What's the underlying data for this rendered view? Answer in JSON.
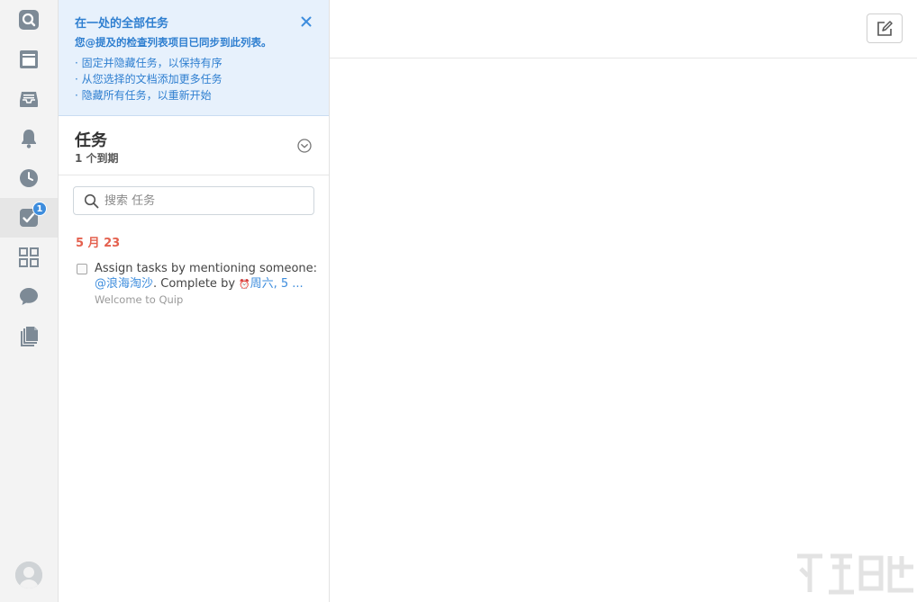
{
  "rail": {
    "items": [
      {
        "icon": "search-icon"
      },
      {
        "icon": "document-icon"
      },
      {
        "icon": "inbox-icon"
      },
      {
        "icon": "bell-icon"
      },
      {
        "icon": "clock-icon"
      },
      {
        "icon": "tasks-check-icon",
        "badge": "1",
        "active": true
      },
      {
        "icon": "grid-icon"
      },
      {
        "icon": "chat-icon"
      },
      {
        "icon": "documents-stack-icon"
      }
    ]
  },
  "banner": {
    "title": "在一处的全部任务",
    "subtitle": "您@提及的检查列表项目已同步到此列表。",
    "bullets": [
      "· 固定并隐藏任务，以保持有序",
      "· 从您选择的文档添加更多任务",
      "· 隐藏所有任务，以重新开始"
    ]
  },
  "tasks": {
    "title": "任务",
    "due_count": "1 个到期"
  },
  "search": {
    "placeholder": "搜索 任务"
  },
  "groups": [
    {
      "date": "5 月 23",
      "items": [
        {
          "text_line1": "Assign tasks by mentioning someone:",
          "mention": "@浪海淘沙",
          "text_mid": ". Complete by ",
          "due": "周六, 5 ...",
          "document": "Welcome to Quip"
        }
      ]
    }
  ],
  "colors": {
    "accent": "#3e8ddd",
    "banner_bg": "#e7f1fc",
    "date_red": "#e4604e",
    "rail_bg": "#f3f3f3"
  }
}
